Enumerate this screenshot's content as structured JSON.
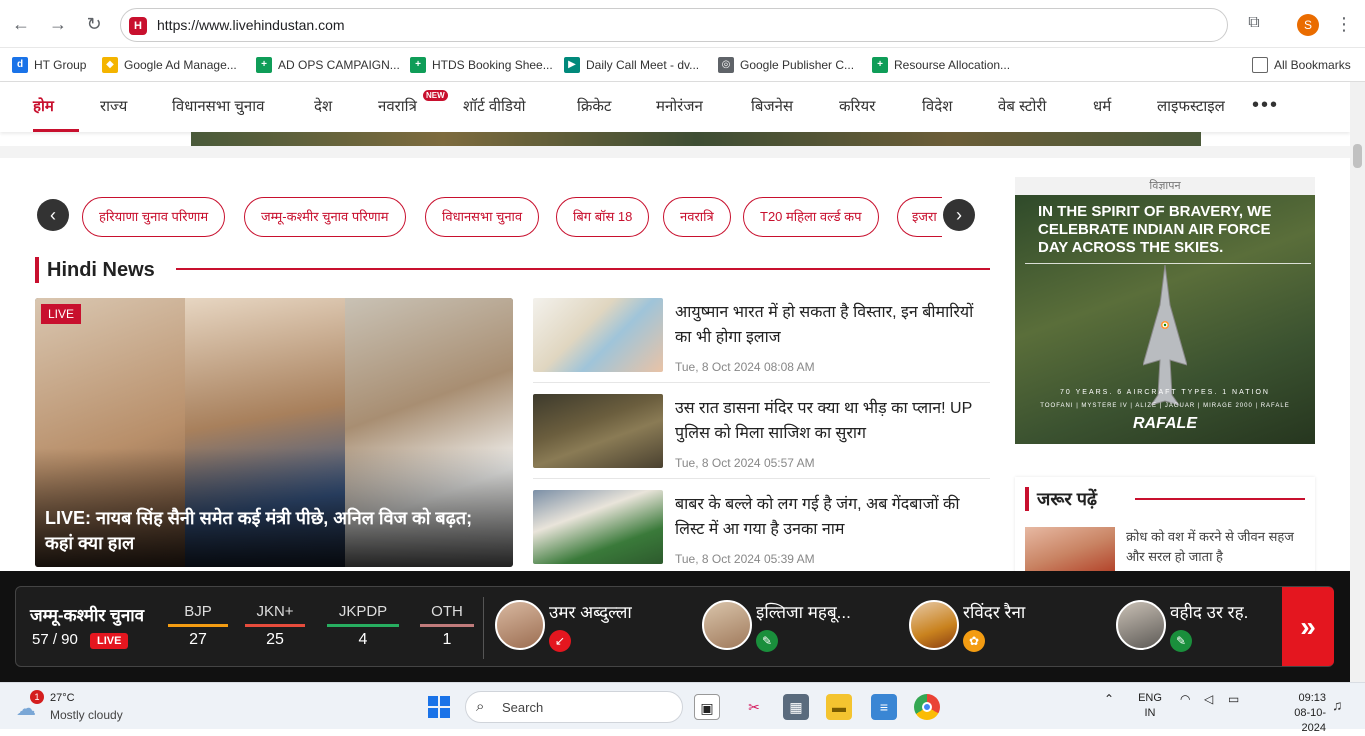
{
  "browser": {
    "url": "https://www.livehindustan.com",
    "profile_initial": "S",
    "bookmarks": [
      {
        "label": "HT Group",
        "icon": "d",
        "color": "#1a73e8"
      },
      {
        "label": "Google Ad Manage...",
        "icon": "google-ad-manager-icon",
        "color": "#f4b400"
      },
      {
        "label": "AD OPS CAMPAIGN...",
        "icon": "+",
        "color": "#0f9d58"
      },
      {
        "label": "HTDS Booking Shee...",
        "icon": "+",
        "color": "#0f9d58"
      },
      {
        "label": "Daily Call Meet - dv...",
        "icon": "meet-icon",
        "color": "#00897b"
      },
      {
        "label": "Google Publisher C...",
        "icon": "globe-icon",
        "color": "#5f6368"
      },
      {
        "label": "Resourse Allocation...",
        "icon": "+",
        "color": "#0f9d58"
      }
    ],
    "all_bookmarks": "All Bookmarks"
  },
  "sitenav": {
    "items": [
      "होम",
      "राज्य",
      "विधानसभा चुनाव",
      "देश",
      "नवरात्रि",
      "शॉर्ट वीडियो",
      "क्रिकेट",
      "मनोरंजन",
      "बिजनेस",
      "करियर",
      "विदेश",
      "वेब स्टोरी",
      "धर्म",
      "लाइफस्टाइल"
    ],
    "new_badge": "NEW",
    "more": "•••"
  },
  "pills": [
    "हरियाणा चुनाव परिणाम",
    "जम्मू-कश्मीर चुनाव परिणाम",
    "विधानसभा चुनाव",
    "बिग बॉस 18",
    "नवरात्रि",
    "T20 महिला वर्ल्ड कप",
    "इजरा"
  ],
  "section": {
    "title": "Hindi News"
  },
  "hero": {
    "tag": "LIVE",
    "title": "LIVE: नायब सिंह सैनी समेत कई मंत्री पीछे, अनिल विज को बढ़त; कहां क्या हाल"
  },
  "stories": [
    {
      "headline": "आयुष्मान भारत में हो सकता है विस्तार, इन बीमारियों का भी होगा इलाज",
      "time": "Tue, 8 Oct 2024 08:08 AM"
    },
    {
      "headline": "उस रात डासना मंदिर पर क्या था भीड़ का प्लान! UP पुलिस को मिला साजिश का सुराग",
      "time": "Tue, 8 Oct 2024 05:57 AM"
    },
    {
      "headline": "बाबर के बल्ले को लग गई है जंग, अब गेंदबाजों की लिस्ट में आ गया है उनका नाम",
      "time": "Tue, 8 Oct 2024 05:39 AM"
    }
  ],
  "ad": {
    "label": "विज्ञापन",
    "headline": "IN THE SPIRIT OF BRAVERY, WE CELEBRATE INDIAN AIR FORCE DAY ACROSS THE SKIES.",
    "tagline": "70 YEARS. 6 AIRCRAFT TYPES. 1 NATION",
    "aircraft": "TOOFANI | MYSTERE IV | ALIZE | JAGUAR | MIRAGE 2000 | RAFALE",
    "brand": "RAFALE"
  },
  "must_read": {
    "title": "जरूर पढ़ें",
    "text": "क्रोध को वश में करने से जीवन सहज और सरल हो जाता है"
  },
  "election": {
    "title": "जम्मू-कश्मीर चुनाव",
    "count": "57 / 90",
    "live": "LIVE",
    "parties": [
      {
        "name": "BJP",
        "value": "27",
        "color": "#f39c12"
      },
      {
        "name": "JKN+",
        "value": "25",
        "color": "#e74c3c"
      },
      {
        "name": "JKPDP",
        "value": "4",
        "color": "#27ae60"
      },
      {
        "name": "OTH",
        "value": "1",
        "color": "#c07b7b"
      }
    ],
    "candidates": [
      {
        "name": "उमर अब्दुल्ला",
        "symbol": "plough-icon",
        "symbol_color": "#e4161f"
      },
      {
        "name": "इल्तिजा महबू...",
        "symbol": "pen-inkpot-icon",
        "symbol_color": "#1a8f3c"
      },
      {
        "name": "रविंदर रैना",
        "symbol": "lotus-icon",
        "symbol_color": "#f39c12"
      },
      {
        "name": "वहीद उर रह.",
        "symbol": "pen-inkpot-icon",
        "symbol_color": "#1a8f3c"
      }
    ],
    "next": "»"
  },
  "taskbar": {
    "weather_badge": "1",
    "temp": "27°C",
    "condition": "Mostly cloudy",
    "search": "Search",
    "lang1": "ENG",
    "lang2": "IN",
    "time": "09:13",
    "date": "08-10-2024"
  }
}
